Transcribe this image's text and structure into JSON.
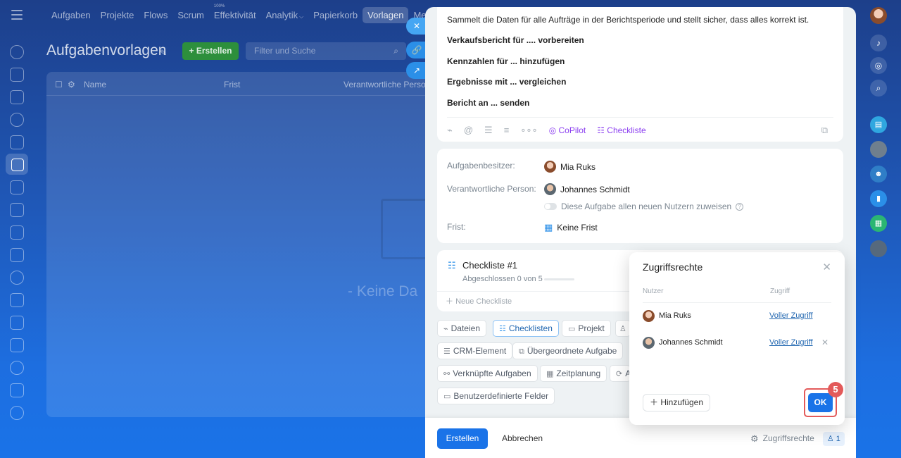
{
  "nav": {
    "items": [
      "Aufgaben",
      "Projekte",
      "Flows",
      "Scrum",
      "Effektivität",
      "Analytik",
      "Papierkorb",
      "Vorlagen",
      "Me"
    ],
    "efficiency_badge": "100%"
  },
  "page": {
    "title": "Aufgabenvorlagen",
    "create_label": "Erstellen",
    "search_placeholder": "Filter und Suche",
    "columns": [
      "Name",
      "Frist",
      "Verantwortliche Person"
    ],
    "empty_text": "- Keine Da"
  },
  "description": {
    "intro": "Sammelt die Daten für alle Aufträge in der Berichtsperiode und stellt sicher, dass alles korrekt ist.",
    "steps": [
      "Verkaufsbericht für .... vorbereiten",
      "Kennzahlen für ... hinzufügen",
      "Ergebnisse mit ... vergleichen",
      "Bericht an ... senden"
    ],
    "toolbar": {
      "copilot": "CoPilot",
      "checklist": "Checkliste"
    }
  },
  "people": {
    "owner_label": "Aufgabenbesitzer:",
    "owner": "Mia Ruks",
    "responsible_label": "Verantwortliche Person:",
    "responsible": "Johannes Schmidt",
    "assign_all": "Diese Aufgabe allen neuen Nutzern zuweisen",
    "deadline_label": "Frist:",
    "deadline": "Keine Frist"
  },
  "checklist": {
    "title": "Checkliste #1",
    "progress_text": "Abgeschlossen 0 von 5",
    "progress_fraction": 0,
    "new_label": "Neue Checkliste"
  },
  "chips": [
    "Dateien",
    "Checklisten",
    "Projekt",
    "CRM-Element",
    "Übergeordnete Aufgabe",
    "Verknüpfte Aufgaben",
    "Zeitplanung",
    "A",
    "Benutzerdefinierte Felder"
  ],
  "footer": {
    "create": "Erstellen",
    "cancel": "Abbrechen",
    "access": "Zugriffsrechte",
    "user_count": "1"
  },
  "popup": {
    "title": "Zugriffsrechte",
    "col_user": "Nutzer",
    "col_access": "Zugriff",
    "rows": [
      {
        "name": "Mia Ruks",
        "access": "Voller Zugriff"
      },
      {
        "name": "Johannes Schmidt",
        "access": "Voller Zugriff"
      }
    ],
    "add": "Hinzufügen",
    "ok": "OK",
    "step": "5"
  },
  "colors": {
    "accent": "#1a73e8",
    "copilot": "#8b3ef0",
    "highlight": "#e35a5a"
  }
}
